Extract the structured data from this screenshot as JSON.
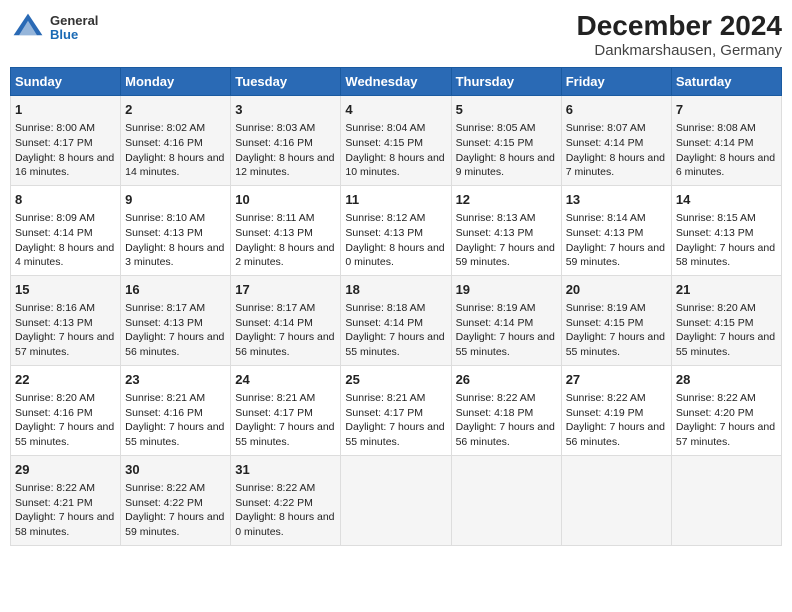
{
  "logo": {
    "general": "General",
    "blue": "Blue"
  },
  "title": "December 2024",
  "subtitle": "Dankmarshausen, Germany",
  "days_of_week": [
    "Sunday",
    "Monday",
    "Tuesday",
    "Wednesday",
    "Thursday",
    "Friday",
    "Saturday"
  ],
  "weeks": [
    [
      {
        "day": "1",
        "sunrise": "Sunrise: 8:00 AM",
        "sunset": "Sunset: 4:17 PM",
        "daylight": "Daylight: 8 hours and 16 minutes."
      },
      {
        "day": "2",
        "sunrise": "Sunrise: 8:02 AM",
        "sunset": "Sunset: 4:16 PM",
        "daylight": "Daylight: 8 hours and 14 minutes."
      },
      {
        "day": "3",
        "sunrise": "Sunrise: 8:03 AM",
        "sunset": "Sunset: 4:16 PM",
        "daylight": "Daylight: 8 hours and 12 minutes."
      },
      {
        "day": "4",
        "sunrise": "Sunrise: 8:04 AM",
        "sunset": "Sunset: 4:15 PM",
        "daylight": "Daylight: 8 hours and 10 minutes."
      },
      {
        "day": "5",
        "sunrise": "Sunrise: 8:05 AM",
        "sunset": "Sunset: 4:15 PM",
        "daylight": "Daylight: 8 hours and 9 minutes."
      },
      {
        "day": "6",
        "sunrise": "Sunrise: 8:07 AM",
        "sunset": "Sunset: 4:14 PM",
        "daylight": "Daylight: 8 hours and 7 minutes."
      },
      {
        "day": "7",
        "sunrise": "Sunrise: 8:08 AM",
        "sunset": "Sunset: 4:14 PM",
        "daylight": "Daylight: 8 hours and 6 minutes."
      }
    ],
    [
      {
        "day": "8",
        "sunrise": "Sunrise: 8:09 AM",
        "sunset": "Sunset: 4:14 PM",
        "daylight": "Daylight: 8 hours and 4 minutes."
      },
      {
        "day": "9",
        "sunrise": "Sunrise: 8:10 AM",
        "sunset": "Sunset: 4:13 PM",
        "daylight": "Daylight: 8 hours and 3 minutes."
      },
      {
        "day": "10",
        "sunrise": "Sunrise: 8:11 AM",
        "sunset": "Sunset: 4:13 PM",
        "daylight": "Daylight: 8 hours and 2 minutes."
      },
      {
        "day": "11",
        "sunrise": "Sunrise: 8:12 AM",
        "sunset": "Sunset: 4:13 PM",
        "daylight": "Daylight: 8 hours and 0 minutes."
      },
      {
        "day": "12",
        "sunrise": "Sunrise: 8:13 AM",
        "sunset": "Sunset: 4:13 PM",
        "daylight": "Daylight: 7 hours and 59 minutes."
      },
      {
        "day": "13",
        "sunrise": "Sunrise: 8:14 AM",
        "sunset": "Sunset: 4:13 PM",
        "daylight": "Daylight: 7 hours and 59 minutes."
      },
      {
        "day": "14",
        "sunrise": "Sunrise: 8:15 AM",
        "sunset": "Sunset: 4:13 PM",
        "daylight": "Daylight: 7 hours and 58 minutes."
      }
    ],
    [
      {
        "day": "15",
        "sunrise": "Sunrise: 8:16 AM",
        "sunset": "Sunset: 4:13 PM",
        "daylight": "Daylight: 7 hours and 57 minutes."
      },
      {
        "day": "16",
        "sunrise": "Sunrise: 8:17 AM",
        "sunset": "Sunset: 4:13 PM",
        "daylight": "Daylight: 7 hours and 56 minutes."
      },
      {
        "day": "17",
        "sunrise": "Sunrise: 8:17 AM",
        "sunset": "Sunset: 4:14 PM",
        "daylight": "Daylight: 7 hours and 56 minutes."
      },
      {
        "day": "18",
        "sunrise": "Sunrise: 8:18 AM",
        "sunset": "Sunset: 4:14 PM",
        "daylight": "Daylight: 7 hours and 55 minutes."
      },
      {
        "day": "19",
        "sunrise": "Sunrise: 8:19 AM",
        "sunset": "Sunset: 4:14 PM",
        "daylight": "Daylight: 7 hours and 55 minutes."
      },
      {
        "day": "20",
        "sunrise": "Sunrise: 8:19 AM",
        "sunset": "Sunset: 4:15 PM",
        "daylight": "Daylight: 7 hours and 55 minutes."
      },
      {
        "day": "21",
        "sunrise": "Sunrise: 8:20 AM",
        "sunset": "Sunset: 4:15 PM",
        "daylight": "Daylight: 7 hours and 55 minutes."
      }
    ],
    [
      {
        "day": "22",
        "sunrise": "Sunrise: 8:20 AM",
        "sunset": "Sunset: 4:16 PM",
        "daylight": "Daylight: 7 hours and 55 minutes."
      },
      {
        "day": "23",
        "sunrise": "Sunrise: 8:21 AM",
        "sunset": "Sunset: 4:16 PM",
        "daylight": "Daylight: 7 hours and 55 minutes."
      },
      {
        "day": "24",
        "sunrise": "Sunrise: 8:21 AM",
        "sunset": "Sunset: 4:17 PM",
        "daylight": "Daylight: 7 hours and 55 minutes."
      },
      {
        "day": "25",
        "sunrise": "Sunrise: 8:21 AM",
        "sunset": "Sunset: 4:17 PM",
        "daylight": "Daylight: 7 hours and 55 minutes."
      },
      {
        "day": "26",
        "sunrise": "Sunrise: 8:22 AM",
        "sunset": "Sunset: 4:18 PM",
        "daylight": "Daylight: 7 hours and 56 minutes."
      },
      {
        "day": "27",
        "sunrise": "Sunrise: 8:22 AM",
        "sunset": "Sunset: 4:19 PM",
        "daylight": "Daylight: 7 hours and 56 minutes."
      },
      {
        "day": "28",
        "sunrise": "Sunrise: 8:22 AM",
        "sunset": "Sunset: 4:20 PM",
        "daylight": "Daylight: 7 hours and 57 minutes."
      }
    ],
    [
      {
        "day": "29",
        "sunrise": "Sunrise: 8:22 AM",
        "sunset": "Sunset: 4:21 PM",
        "daylight": "Daylight: 7 hours and 58 minutes."
      },
      {
        "day": "30",
        "sunrise": "Sunrise: 8:22 AM",
        "sunset": "Sunset: 4:22 PM",
        "daylight": "Daylight: 7 hours and 59 minutes."
      },
      {
        "day": "31",
        "sunrise": "Sunrise: 8:22 AM",
        "sunset": "Sunset: 4:22 PM",
        "daylight": "Daylight: 8 hours and 0 minutes."
      },
      null,
      null,
      null,
      null
    ]
  ]
}
